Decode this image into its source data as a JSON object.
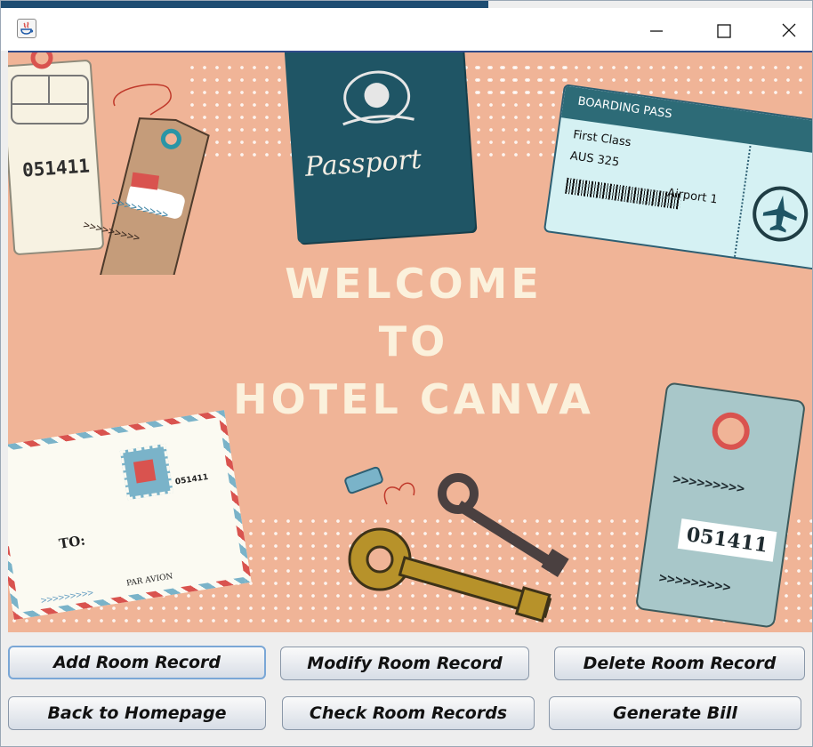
{
  "hero": {
    "welcome_line1": "WELCOME",
    "welcome_line2": "TO",
    "welcome_line3": "HOTEL CANVA",
    "passport_text": "Passport",
    "boarding_title": "BOARDING PASS",
    "boarding_class": "First Class",
    "boarding_flight": "AUS 325",
    "boarding_airport": "Airport 1",
    "tag_number": "051411",
    "left_tag_number": "051411",
    "stamp_number": "051411",
    "envelope_to": "TO:",
    "envelope_airmail": "PAR AVION",
    "chevrons": ">>>>>>>>>"
  },
  "buttons": {
    "add": "Add Room Record",
    "modify": "Modify Room Record",
    "delete": "Delete Room Record",
    "back": "Back to Homepage",
    "check": "Check Room Records",
    "bill": "Generate Bill"
  },
  "colors": {
    "background": "#f0b497",
    "welcome_text": "#fbf1dc",
    "passport": "#1f5565",
    "boarding": "#d5f1f3"
  }
}
